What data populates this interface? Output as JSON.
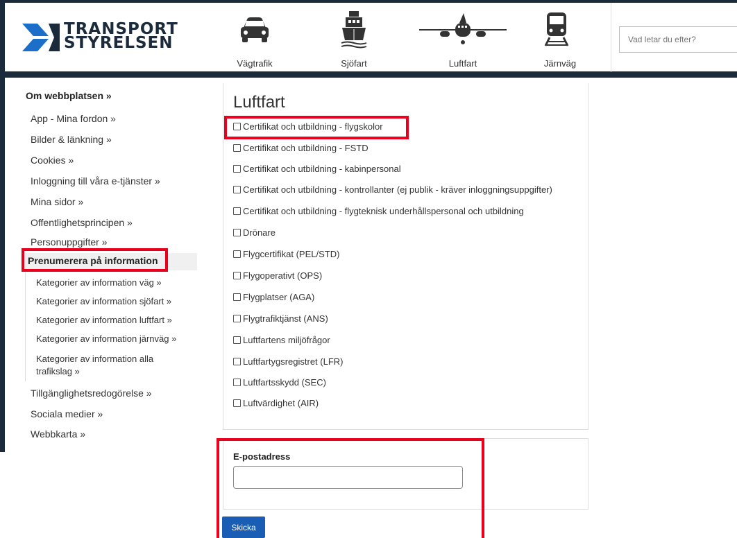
{
  "header": {
    "logo_line1": "TRANSPORT",
    "logo_line2": "STYRELSEN",
    "nav": [
      {
        "label": "Vägtrafik",
        "icon": "car-icon"
      },
      {
        "label": "Sjöfart",
        "icon": "ship-icon"
      },
      {
        "label": "Luftfart",
        "icon": "airplane-icon"
      },
      {
        "label": "Järnväg",
        "icon": "train-icon"
      }
    ],
    "search_placeholder": "Vad letar du efter?"
  },
  "sidebar": {
    "top_link": "Om webbplatsen »",
    "links": [
      "App - Mina fordon »",
      "Bilder & länkning »",
      "Cookies »",
      "Inloggning till våra e-tjänster »",
      "Mina sidor »",
      "Offentlighetsprincipen »",
      "Personuppgifter »"
    ],
    "active": "Prenumerera på information",
    "sub_links": [
      "Kategorier av information väg »",
      "Kategorier av information sjöfart »",
      "Kategorier av information luftfart »",
      "Kategorier av information järnväg »",
      "Kategorier av information alla",
      "trafikslag »"
    ],
    "bottom_links": [
      "Tillgänglighetsredogörelse »",
      "Sociala medier »",
      "Webbkarta »"
    ]
  },
  "main": {
    "title": "Luftfart",
    "checkboxes": [
      "Certifikat och utbildning - flygskolor",
      "Certifikat och utbildning - FSTD",
      "Certifikat och utbildning - kabinpersonal",
      "Certifikat och utbildning - kontrollanter (ej publik - kräver inloggningsuppgifter)",
      "Certifikat och utbildning - flygteknisk underhållspersonal och utbildning",
      "Drönare",
      "Flygcertifikat (PEL/STD)",
      "Flygoperativt (OPS)",
      "Flygplatser (AGA)",
      "Flygtrafiktjänst (ANS)",
      "Luftfartens miljöfrågor",
      "Luftfartygsregistret (LFR)",
      "Luftfartsskydd (SEC)",
      "Luftvärdighet (AIR)"
    ],
    "email_label": "E-postadress",
    "email_value": "",
    "submit_label": "Skicka"
  }
}
